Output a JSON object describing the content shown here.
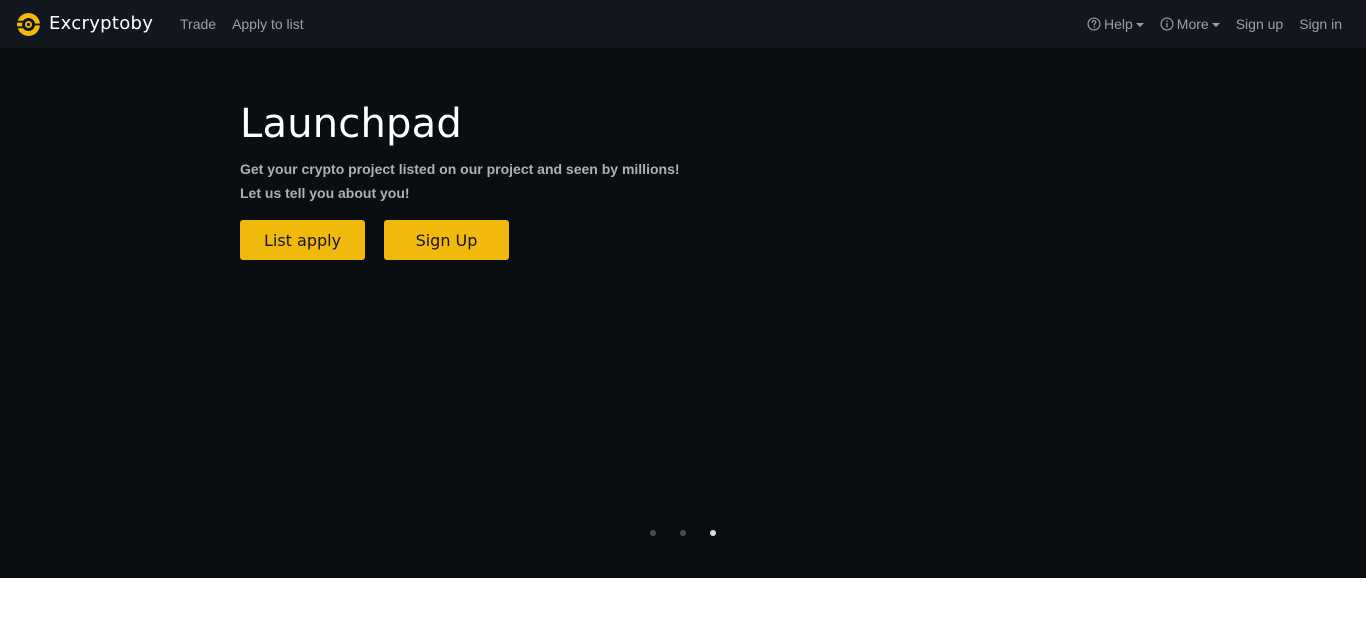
{
  "navbar": {
    "brand_name": "Excryptoby",
    "left_links": [
      "Trade",
      "Apply to list"
    ],
    "help_label": "Help",
    "more_label": "More",
    "signup_label": "Sign up",
    "signin_label": "Sign in",
    "icons": {
      "logo": "brand-logo-icon",
      "help": "question-circle-icon",
      "more": "info-circle-icon",
      "caret": "caret-down-icon"
    }
  },
  "hero": {
    "title": "Launchpad",
    "subtitle_line1": "Get your crypto project listed on our project and seen by millions!",
    "subtitle_line2": "Let us tell you about you!",
    "primary_button": "List apply",
    "secondary_button": "Sign Up",
    "carousel": {
      "count": 3,
      "active_index": 2
    }
  },
  "colors": {
    "navbar_bg": "#12161f",
    "hero_bg": "#0b0e11",
    "accent": "#f0b90b",
    "nav_text": "#9aa0aa",
    "subtitle_text": "#aab0ba"
  }
}
